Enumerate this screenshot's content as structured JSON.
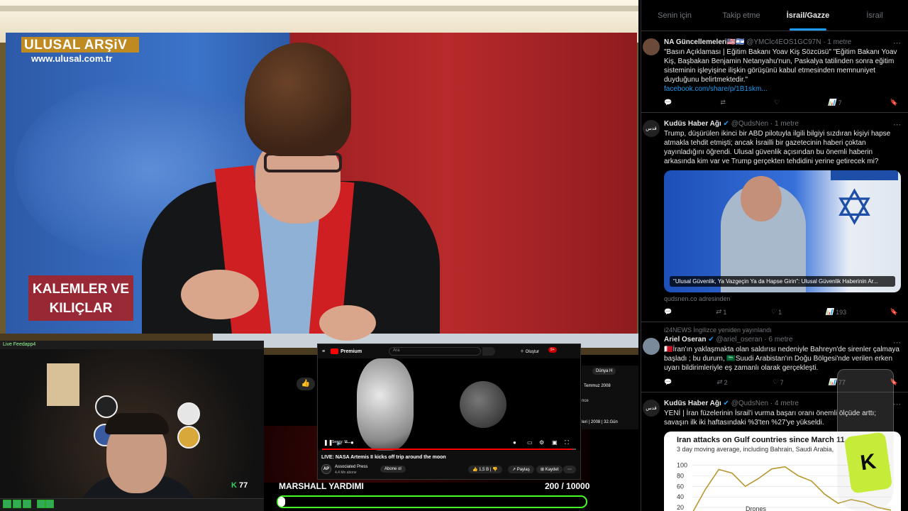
{
  "main_video": {
    "logo_title": "ULUSAL ARŞiV",
    "logo_url": "www.ulusal.com.tr",
    "lower_third": "KALEMLER VE\nKILIÇLAR"
  },
  "twitter": {
    "tabs": [
      {
        "label": "Senin için"
      },
      {
        "label": "Takip etme"
      },
      {
        "label": "İsrail/Gazze"
      },
      {
        "label": "İsrail"
      }
    ],
    "tweets": [
      {
        "name": "NA Güncellemeleri🇺🇸🇮🇱",
        "handle": "@YMClc4EOS1GC97N",
        "time": "· 1 metre",
        "text": "\"Basın Açıklaması | Eğitim Bakanı Yoav Kiş Sözcüsü\" \"Eğitim Bakanı Yoav Kiş, Başbakan Benjamin Netanyahu'nun, Paskalya tatilinden sonra eğitim sisteminin işleyişine ilişkin görüşünü kabul etmesinden memnuniyet duyduğunu belirtmektedir.\"",
        "link": "facebook.com/share/p/1B1skm...",
        "views": "7"
      },
      {
        "name": "Kudüs Haber Ağı",
        "handle": "@QudsNen",
        "time": "· 1 metre",
        "text": "Trump, düşürülen ikinci bir ABD pilotuyla ilgili bilgiyi sızdıran kişiyi hapse atmakla tehdit etmişti; ancak İsrailli bir gazetecinin haberi çoktan yayınladığını öğrendi. Ulusal güvenlik açısından bu önemli haberin arkasında kim var ve Trump gerçekten tehdidini yerine getirecek mi?",
        "media_caption": "\"Ulusal Güvenlik, Ya Vazgeçin Ya da Hapse Girin\": Ulusal Güvenlik Haberinin Ar...",
        "domain": "qudsnen.co adresinden",
        "reposts": "1",
        "likes": "1",
        "views": "193"
      },
      {
        "repost_note": "i24NEWS İngilizce yeniden yayınlandı",
        "name": "Ariel Oseran",
        "handle": "@ariel_oseran",
        "time": "· 6 metre",
        "text": "🇧🇭İran'ın yaklaşmakta olan saldırısı nedeniyle Bahreyn'de sirenler çalmaya başladı ; bu durum, 🇸🇦Suudi Arabistan'ın Doğu Bölgesi'nde verilen erken uyarı bildirimleriyle eş zamanlı olarak gerçekleşti.",
        "reposts": "2",
        "likes": "7",
        "views": "77"
      },
      {
        "name": "Kudüs Haber Ağı",
        "handle": "@QudsNen",
        "time": "· 4 metre",
        "text": "YENİ | İran füzelerinin İsrail'i vurma başarı oranı önemli ölçüde arttı; savaşın ilk iki haftasındaki %3'ten %27'ye yükseldi.",
        "chart_title": "Iran attacks on Gulf countries since March 11, 2",
        "chart_subtitle": "3 day moving average, including Bahrain, Saudi Arabia,"
      }
    ]
  },
  "chart_data": {
    "type": "line",
    "title": "Iran attacks on Gulf countries since March 11, 2",
    "subtitle": "3 day moving average, including Bahrain, Saudi Arabia,",
    "y_ticks": [
      100,
      80,
      60,
      40,
      20
    ],
    "ylim": [
      0,
      110
    ],
    "series": [
      {
        "name": "Drones",
        "values": [
          10,
          55,
          92,
          85,
          60,
          75,
          93,
          97,
          80,
          70,
          45,
          28,
          35,
          30,
          20,
          15
        ]
      }
    ],
    "series_color": "#b8962e"
  },
  "webcam": {
    "title": "Live Feedapp4",
    "counter": "77",
    "counter_icon": "K"
  },
  "youtube": {
    "brand": "Premium",
    "search_placeholder": "Ara",
    "create_label": "Oluştur",
    "notifications": "9+",
    "video_label": "Sessiz: M",
    "title": "LIVE: NASA Artemis II kicks off trip around the moon",
    "channel": "Associated Press",
    "subscribers": "4,4 Mn abone",
    "subscribe": "Abone ol",
    "likes": "1,5 B",
    "share": "Paylaş",
    "save": "Kaydet",
    "progress": 0.985
  },
  "youtube_background": {
    "chip": "Dünya H",
    "date": "Temmuz 2008",
    "note": "nce",
    "meta": "leri | 2008 | 32.Gün"
  },
  "marshall": {
    "label": "MARSHALL YARDIMI",
    "count": "200 / 10000",
    "progress": 0.02
  }
}
